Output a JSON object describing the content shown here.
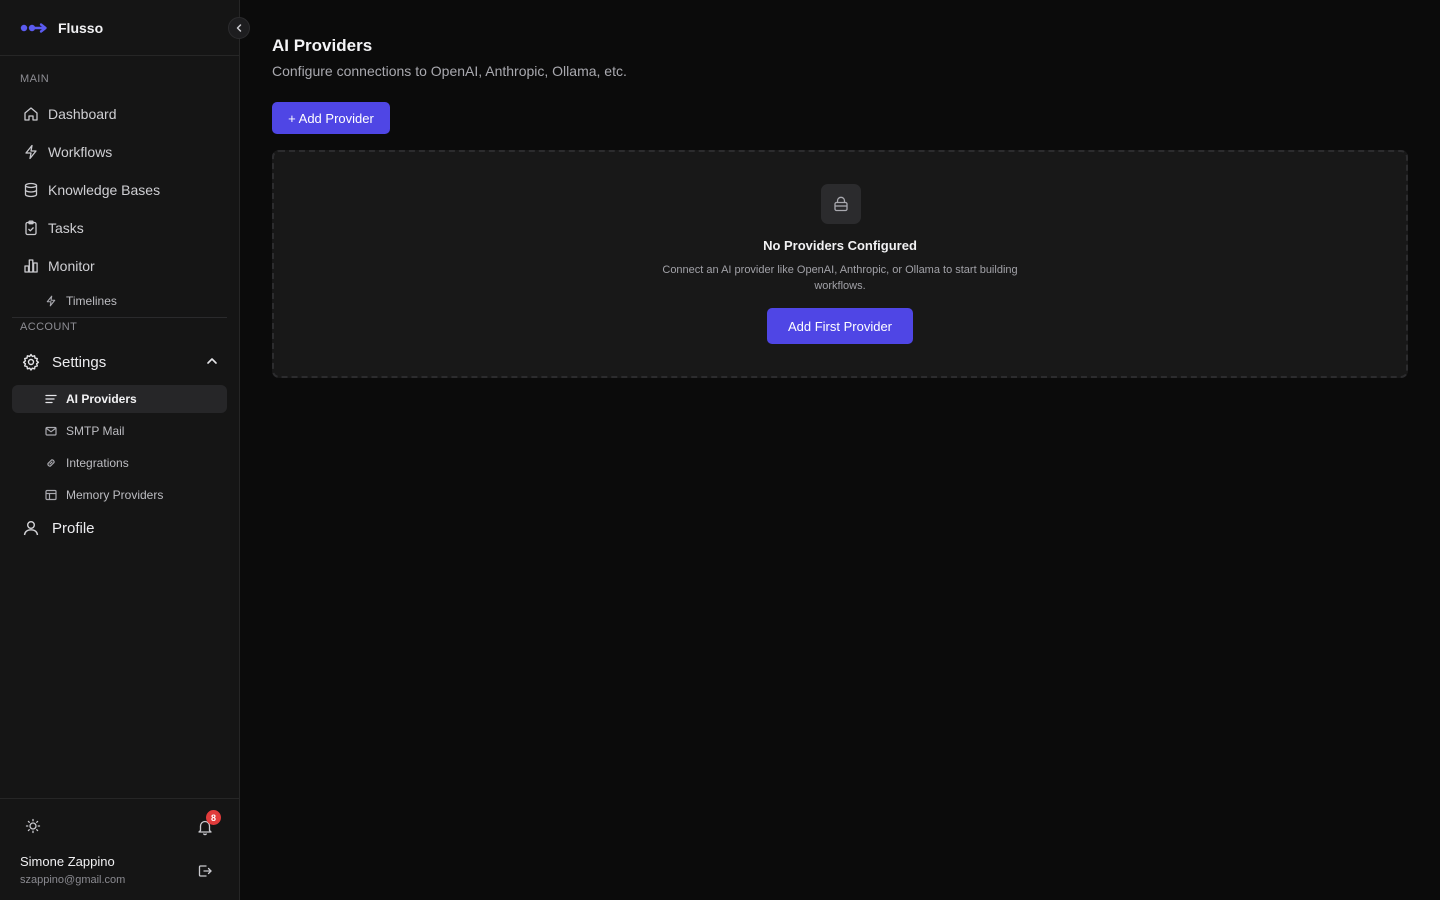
{
  "app": {
    "name": "Flusso",
    "accent": "#4f46e5"
  },
  "sidebar": {
    "main_label": "MAIN",
    "main_items": [
      {
        "label": "Dashboard",
        "icon": "home-icon"
      },
      {
        "label": "Workflows",
        "icon": "lightning-icon"
      },
      {
        "label": "Knowledge Bases",
        "icon": "database-icon"
      },
      {
        "label": "Tasks",
        "icon": "clipboard-check-icon"
      },
      {
        "label": "Monitor",
        "icon": "bar-chart-icon"
      }
    ],
    "monitor_sub": [
      {
        "label": "Timelines",
        "icon": "lightning-icon"
      }
    ],
    "account_label": "ACCOUNT",
    "settings": {
      "label": "Settings",
      "icon": "gear-icon",
      "expanded": true,
      "items": [
        {
          "label": "AI Providers",
          "icon": "list-icon",
          "active": true
        },
        {
          "label": "SMTP Mail",
          "icon": "mail-icon",
          "active": false
        },
        {
          "label": "Integrations",
          "icon": "link-icon",
          "active": false
        },
        {
          "label": "Memory Providers",
          "icon": "table-icon",
          "active": false
        }
      ]
    },
    "profile": {
      "label": "Profile",
      "icon": "user-icon"
    },
    "footer": {
      "notification_count": "8",
      "user_name": "Simone Zappino",
      "user_email": "szappino@gmail.com"
    }
  },
  "main": {
    "title": "AI Providers",
    "subtitle": "Configure connections to OpenAI, Anthropic, Ollama, etc.",
    "add_button": "+ Add Provider",
    "empty_state": {
      "icon": "lock-icon",
      "title": "No Providers Configured",
      "description": "Connect an AI provider like OpenAI, Anthropic, or Ollama to start building workflows.",
      "button": "Add First Provider"
    }
  }
}
